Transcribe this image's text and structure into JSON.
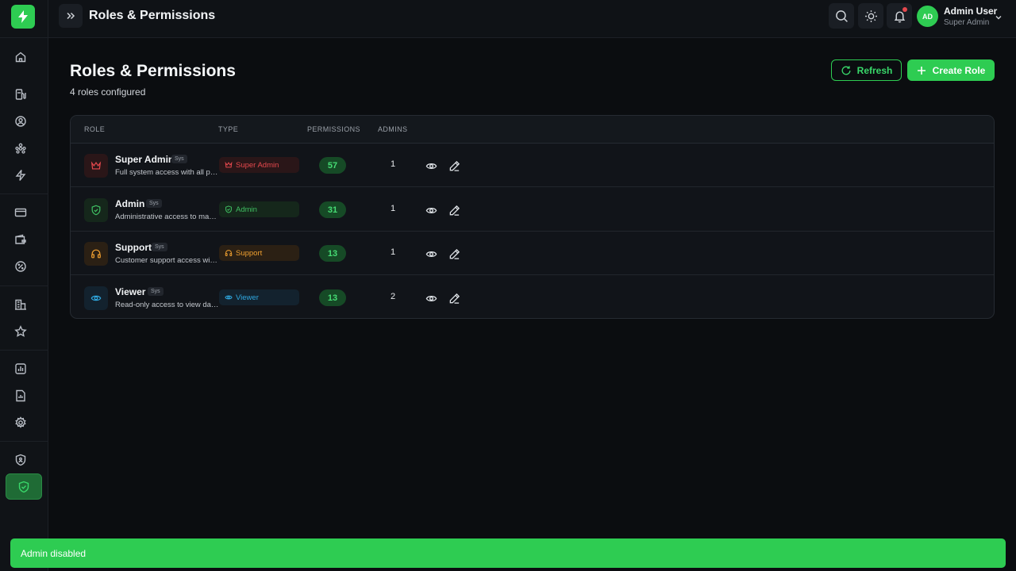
{
  "topbar": {
    "title": "Roles & Permissions",
    "user_initials": "AD",
    "user_name": "Admin User",
    "user_role": "Super Admin"
  },
  "page": {
    "title": "Roles & Permissions",
    "subtitle": "4 roles configured",
    "refresh_label": "Refresh",
    "create_label": "Create Role"
  },
  "table": {
    "headers": [
      "ROLE",
      "TYPE",
      "PERMISSIONS",
      "ADMINS"
    ],
    "rows": [
      {
        "name": "Super Admin",
        "tag": "Sys",
        "description": "Full system access with all permissions",
        "type": "Super Admin",
        "permissions": "57",
        "admins": "1",
        "icon": "crown-icon"
      },
      {
        "name": "Admin",
        "tag": "Sys",
        "description": "Administrative access to manage platform",
        "type": "Admin",
        "permissions": "31",
        "admins": "1",
        "icon": "shield-check-icon"
      },
      {
        "name": "Support",
        "tag": "Sys",
        "description": "Customer support access with limited permissions",
        "type": "Support",
        "permissions": "13",
        "admins": "1",
        "icon": "headphones-icon"
      },
      {
        "name": "Viewer",
        "tag": "Sys",
        "description": "Read-only access to view dashboard data",
        "type": "Viewer",
        "permissions": "13",
        "admins": "2",
        "icon": "eye-icon"
      }
    ]
  },
  "toast": {
    "message": "Admin disabled"
  },
  "colors": {
    "accent": "#2ecc52",
    "super_admin": "#e5484d",
    "admin": "#3fbf62",
    "support": "#f0a030",
    "viewer": "#2fa8e0"
  }
}
